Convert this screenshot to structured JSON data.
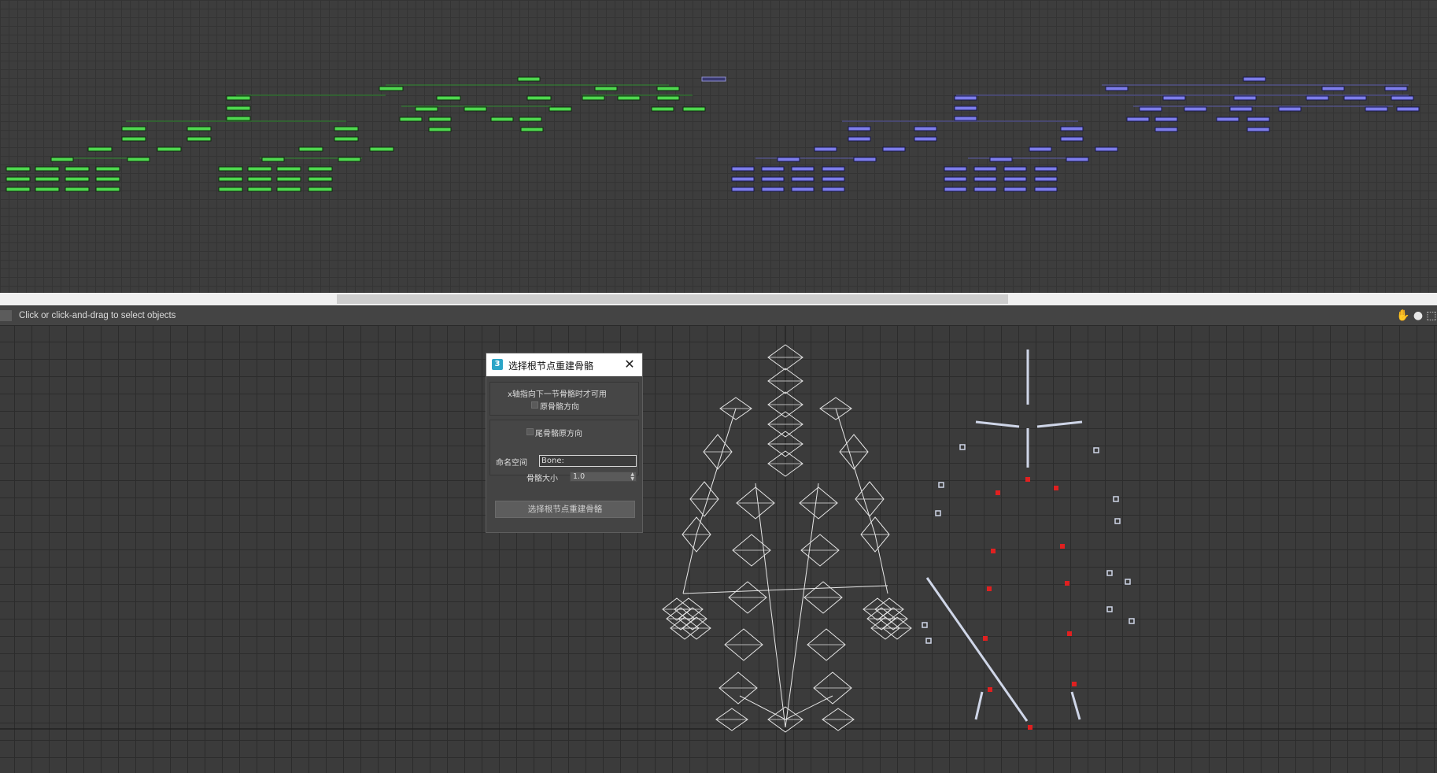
{
  "status": {
    "message": "Click or click-and-drag to select objects",
    "icons": [
      "hand-pan-icon",
      "orbit-icon",
      "maximize-icon"
    ]
  },
  "dialog": {
    "title": "选择根节点重建骨骼",
    "app_icon_label": "3",
    "x_axis_note": "x轴指向下一节骨骼时才可用",
    "original_bone_direction_label": "原骨骼方向",
    "tail_bone_direction_label": "尾骨骼原方向",
    "namespace_label": "命名空间",
    "namespace_value": "Bone:",
    "bone_size_label": "骨骼大小",
    "bone_size_value": "1.0",
    "rebuild_button_label": "选择根节点重建骨骼"
  },
  "colors": {
    "node_green": "#4fd84f",
    "node_blue": "#7d7dea",
    "viewport_bg": "#3b3b3b",
    "bone_wire": "#e6e6e6",
    "marker_red": "#e02020"
  }
}
